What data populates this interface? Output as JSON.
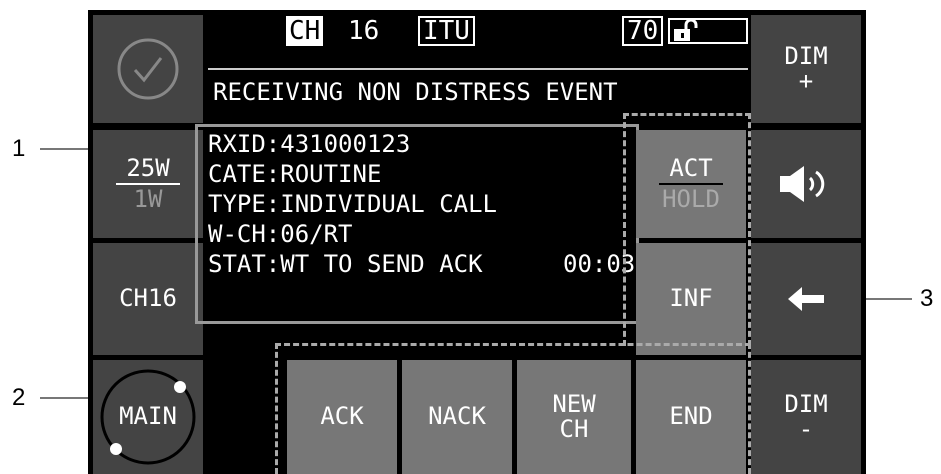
{
  "header": {
    "ch_label": "CH",
    "ch_number": "16",
    "ch_mode": "ITU",
    "volume": "70",
    "status_line": "RECEIVING NON DISTRESS EVENT"
  },
  "left": {
    "power_high": "25W",
    "power_low": "1W",
    "ch16": "CH16",
    "main": "MAIN"
  },
  "message": {
    "rxid": "RXID:431000123",
    "cate": "CATE:ROUTINE",
    "type": "TYPE:INDIVIDUAL CALL",
    "wch": "W-CH:06/RT",
    "stat": "STAT:WT TO SEND ACK",
    "timer": "00:03"
  },
  "center_right": {
    "act": "ACT",
    "hold": "HOLD",
    "inf": "INF",
    "end": "END"
  },
  "bottom": {
    "ack": "ACK",
    "nack": "NACK",
    "new_ch_top": "NEW",
    "new_ch_bottom": "CH"
  },
  "right": {
    "dim_plus_top": "DIM",
    "dim_plus_bottom": "+",
    "dim_minus_top": "DIM",
    "dim_minus_bottom": "-"
  },
  "callouts": {
    "c1": "1",
    "c2": "2",
    "c3": "3"
  }
}
